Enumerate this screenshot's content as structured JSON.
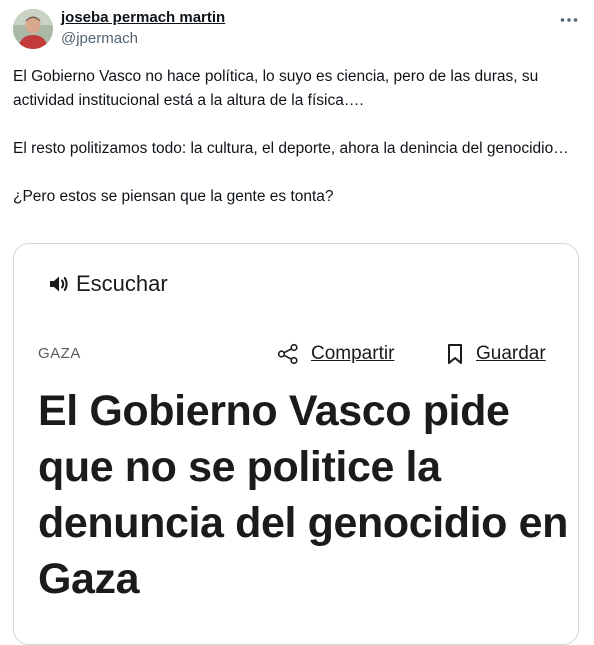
{
  "tweet": {
    "author_name": "joseba permach martin",
    "author_handle": "@jpermach",
    "more_icon": "more-horizontal-icon",
    "paragraphs": [
      "El Gobierno Vasco no hace política, lo suyo es ciencia, pero de las duras, su actividad institucional está a la altura de la física….",
      "El resto politizamos todo: la cultura, el deporte, ahora la denincia del genocidio…",
      "¿Pero estos se piensan que la gente es tonta?"
    ]
  },
  "card": {
    "listen_label": "Escuchar",
    "listen_icon": "speaker-icon",
    "section": "GAZA",
    "share_label": "Compartir",
    "share_icon": "share-icon",
    "save_label": "Guardar",
    "save_icon": "bookmark-icon",
    "headline": "El Gobierno Vasco pide que no se politice la denuncia del genocidio en Gaza"
  },
  "colors": {
    "text": "#0f1419",
    "secondary_text": "#536471",
    "card_border": "#cfd9de",
    "headline": "#1b1b1b"
  }
}
